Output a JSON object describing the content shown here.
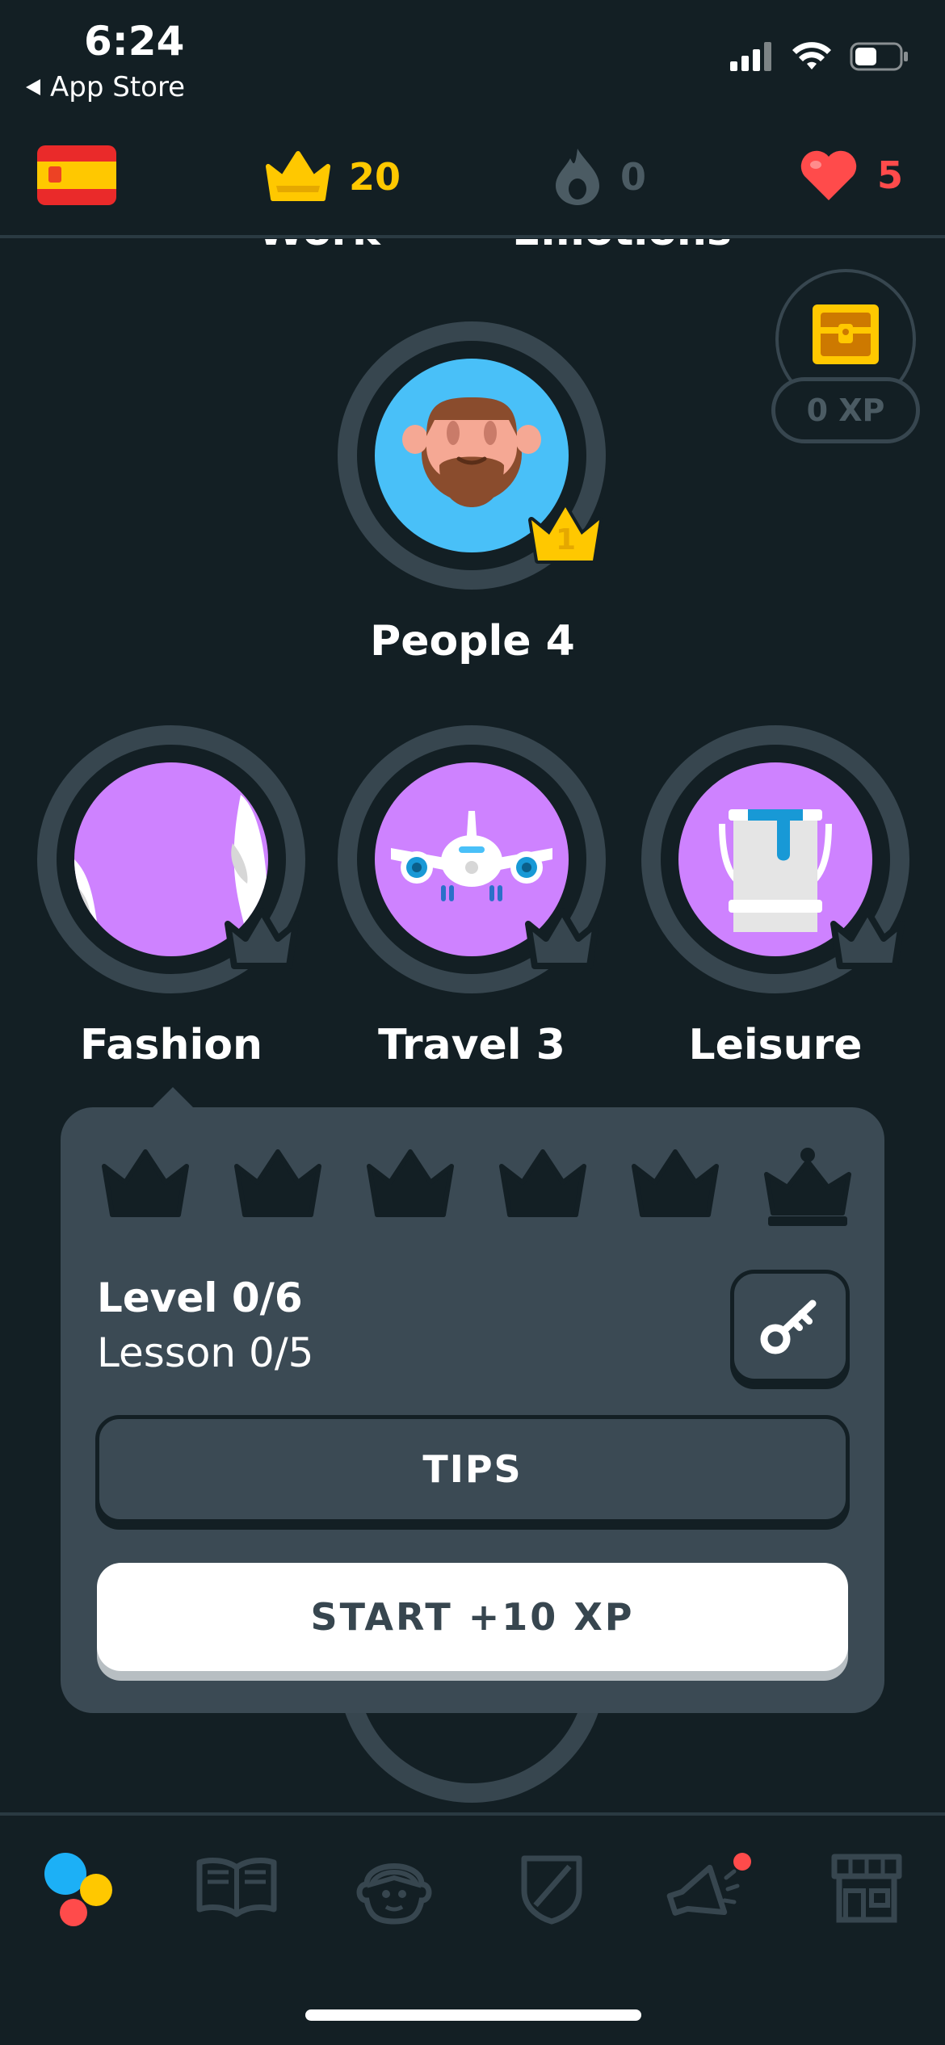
{
  "status_bar": {
    "time": "6:24",
    "back_label": "App Store"
  },
  "stats": {
    "language_flag": "spain-flag-icon",
    "crowns": "20",
    "streak": "0",
    "hearts": "5",
    "colors": {
      "crown": "#ffc800",
      "streak": "#4b5b63",
      "hearts": "#ff4b4b"
    }
  },
  "skills": {
    "partial_above": [
      "Work",
      "Emotions"
    ],
    "featured": {
      "title": "People 4",
      "crown_level": "1"
    },
    "row": [
      {
        "title": "Fashion"
      },
      {
        "title": "Travel 3"
      },
      {
        "title": "Leisure"
      }
    ]
  },
  "chest": {
    "xp_label": "0 XP"
  },
  "popup": {
    "level_text": "Level 0/6",
    "lesson_text": "Lesson 0/5",
    "tips_label": "TIPS",
    "start_label": "START +10 XP"
  },
  "nav": {
    "items": [
      "learn-icon",
      "stories-icon",
      "profile-icon",
      "leagues-icon",
      "news-icon",
      "shop-icon"
    ]
  },
  "colors": {
    "background": "#131f24",
    "panel": "#3b4a54",
    "skill_purple": "#ce82ff",
    "skill_blue": "#49c0f8"
  }
}
